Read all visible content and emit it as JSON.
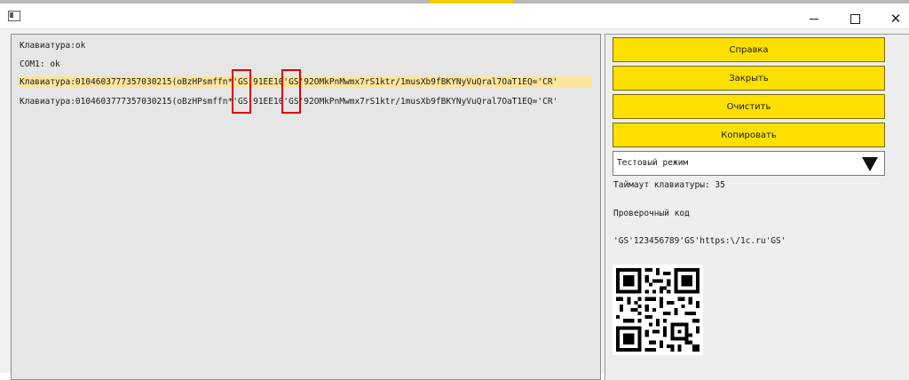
{
  "window": {
    "buttons": {
      "minimize": "minimize",
      "maximize": "maximize",
      "close": "✕"
    }
  },
  "log": {
    "lines": [
      "Клавиатура:ok",
      "COM1: ok",
      "Клавиатура:0104603777357030215(oBzHPsmffn*'GS'91EE10'GS'92OMkPnMwmx7rS1ktr/1musXb9fBKYNyVuQral7OaT1EQ='CR'",
      "Клавиатура:0104603777357030215(oBzHPsmffn*'GS'91EE10'GS'92OMkPnMwmx7rS1ktr/1musXb9fBKYNyVuQral7OaT1EQ='CR'"
    ]
  },
  "side": {
    "buttons": [
      "Справка",
      "Закрыть",
      "Очистить",
      "Копировать"
    ],
    "mode_select": {
      "value": "Тестовый режим"
    },
    "timeout_label": "Таймаут клавиатуры: 35",
    "verify_label": "Проверочный код",
    "verify_code": "'GS'123456789'GS'https:\\/1c.ru'GS'"
  },
  "colors": {
    "accent": "#fde000",
    "highlight": "#fde59a",
    "mark": "#e00000"
  }
}
